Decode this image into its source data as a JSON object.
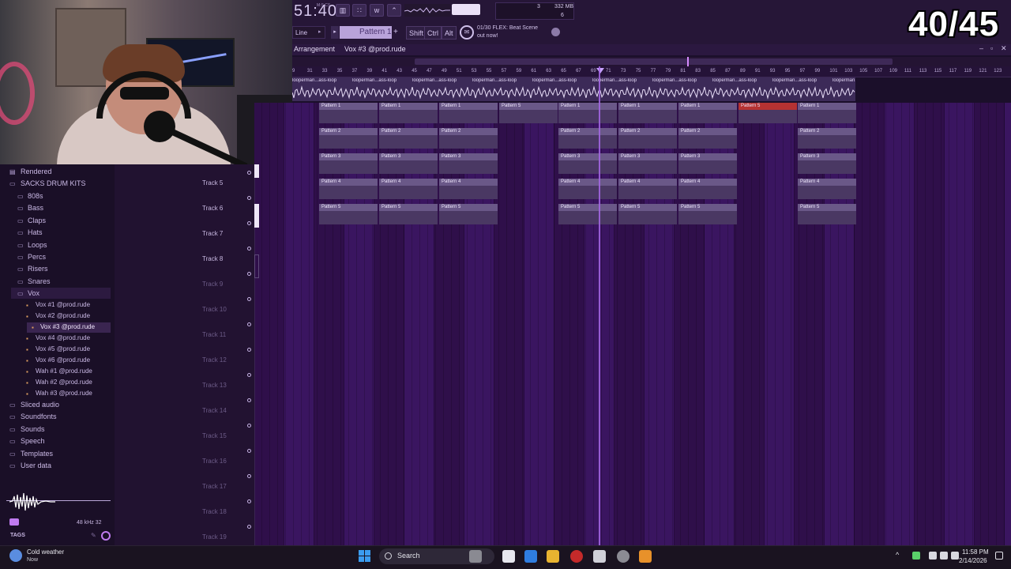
{
  "overlay": {
    "counter": "40/45"
  },
  "toolbar": {
    "song_time": "51:40",
    "time_unit": "M:S:CS",
    "cpu_value": "3",
    "memory": "332 MB",
    "polyphony": "6",
    "snap_mode": "Line",
    "pattern_name": "Pattern 1",
    "shift_label": "Shift",
    "ctrl_label": "Ctrl",
    "alt_label": "Alt",
    "news_line1": "01/30  FLEX: Beat Scene",
    "news_line2": "out now!"
  },
  "arrangement": {
    "title": "Arrangement",
    "crumb": "Vox #3 @prod.rude",
    "ruler_numbers": [
      "9",
      "31",
      "33",
      "35",
      "37",
      "39",
      "41",
      "43",
      "45",
      "47",
      "49",
      "51",
      "53",
      "55",
      "57",
      "59",
      "61",
      "63",
      "65",
      "67",
      "69",
      "71",
      "73",
      "75",
      "77",
      "79",
      "81",
      "83",
      "85",
      "87",
      "89",
      "91",
      "93",
      "95",
      "97",
      "99",
      "101",
      "103",
      "105",
      "107",
      "109",
      "111",
      "113",
      "115",
      "117",
      "119",
      "121",
      "123"
    ],
    "audio_clip_label": "looperman...ass-loop",
    "selected_pattern": "Pattern 5"
  },
  "tracks": [
    "Track 5",
    "Track 6",
    "Track 7",
    "Track 8",
    "Track 9",
    "Track 10",
    "Track 11",
    "Track 12",
    "Track 13",
    "Track 14",
    "Track 15",
    "Track 16",
    "Track 17",
    "Track 18",
    "Track 19"
  ],
  "patterns": {
    "row1": "Pattern 1",
    "row2": "Pattern 2",
    "row3": "Pattern 3",
    "row4": "Pattern 4",
    "row5": "Pattern 5"
  },
  "browser": {
    "rendered": "Rendered",
    "kit": "SACKS DRUM KITS",
    "folders": [
      "808s",
      "Bass",
      "Claps",
      "Hats",
      "Loops",
      "Percs",
      "Risers",
      "Snares",
      "Vox"
    ],
    "vox_files": [
      "Vox #1 @prod.rude",
      "Vox #2 @prod.rude",
      "Vox #3 @prod.rude",
      "Vox #4 @prod.rude",
      "Vox #5 @prod.rude",
      "Vox #6 @prod.rude",
      "Wah #1 @prod.rude",
      "Wah #2 @prod.rude",
      "Wah #3 @prod.rude"
    ],
    "root_items": [
      "Sliced audio",
      "Soundfonts",
      "Sounds",
      "Speech",
      "Templates",
      "User data"
    ],
    "sample_rate": "48 kHz 32",
    "tags_label": "TAGS"
  },
  "taskbar": {
    "weather_title": "Cold weather",
    "weather_sub": "Now",
    "search_label": "Search",
    "clock_time": "11:58 PM",
    "clock_date": "2/14/2026"
  }
}
